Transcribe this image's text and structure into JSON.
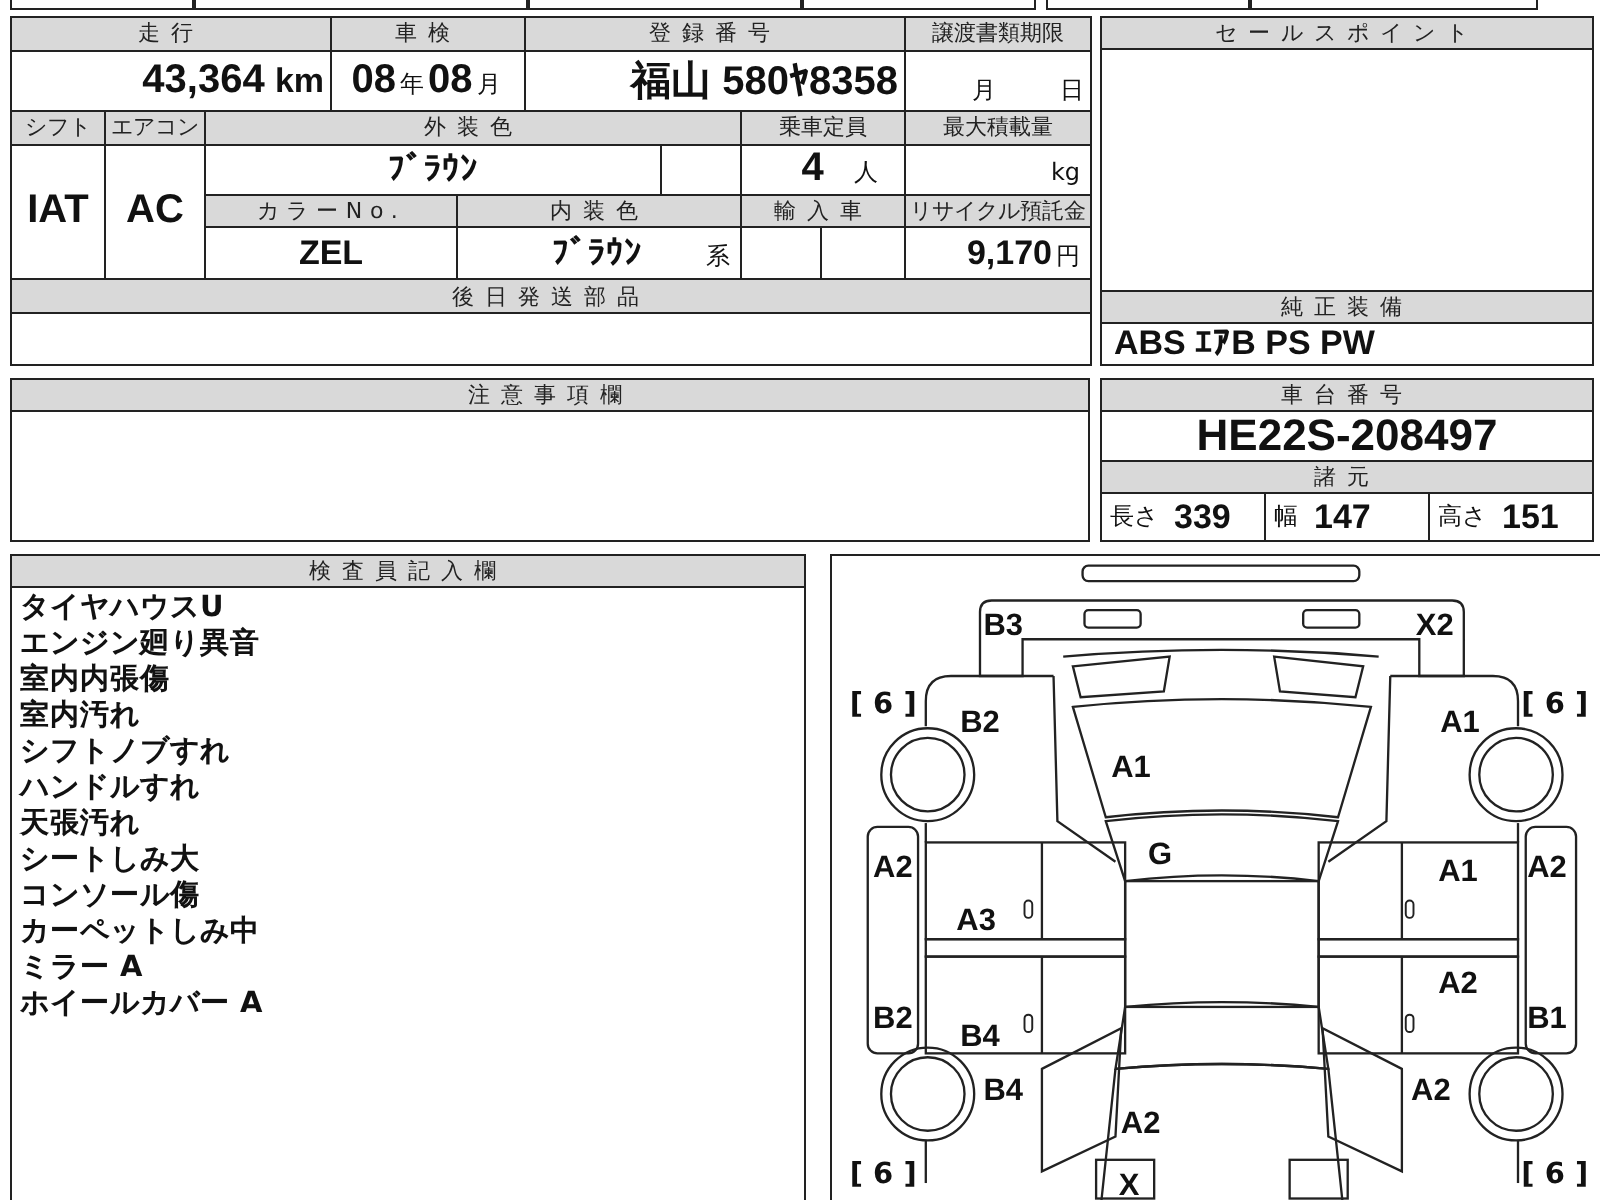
{
  "vehicle_table": {
    "mileage": {
      "label": "走行",
      "value": "43,364",
      "unit": "km"
    },
    "inspection": {
      "label": "車検",
      "year": "08",
      "year_unit": "年",
      "month": "08",
      "month_unit": "月"
    },
    "registration": {
      "label": "登録番号",
      "value": "福山 580ﾔ8358"
    },
    "transfer_deadline": {
      "label": "譲渡書類期限",
      "month_unit": "月",
      "day_unit": "日"
    },
    "shift": {
      "label": "シフト",
      "value": "IAT"
    },
    "air_conditioner": {
      "label": "エアコン",
      "value": "AC"
    },
    "exterior_color": {
      "label": "外装色",
      "value": "ﾌﾞﾗｳﾝ"
    },
    "seating_capacity": {
      "label": "乗車定員",
      "value": "4",
      "unit": "人"
    },
    "max_load": {
      "label": "最大積載量",
      "unit": "kg"
    },
    "color_no": {
      "label": "カラーNo.",
      "value": "ZEL"
    },
    "interior_color": {
      "label": "内装色",
      "value": "ﾌﾞﾗｳﾝ",
      "suffix": "系"
    },
    "imported": {
      "label": "輸入車"
    },
    "recycle_fee": {
      "label": "リサイクル預託金",
      "value": "9,170",
      "unit": "円"
    },
    "parts_to_ship": {
      "label": "後日発送部品"
    }
  },
  "sales_points": {
    "title": "セールスポイント"
  },
  "standard_equipment": {
    "title": "純正装備",
    "value": "ABS ｴｱB PS PW"
  },
  "notes": {
    "title": "注意事項欄"
  },
  "chassis": {
    "title": "車台番号",
    "value": "HE22S-208497",
    "specs_title": "諸元",
    "specs": [
      {
        "label": "長さ",
        "value": "339"
      },
      {
        "label": "幅",
        "value": "147"
      },
      {
        "label": "高さ",
        "value": "151"
      }
    ]
  },
  "inspector": {
    "title": "検査員記入欄",
    "notes": [
      "タイヤハウスU",
      "エンジン廻り異音",
      "室内内張傷",
      "室内汚れ",
      "シフトノブすれ",
      "ハンドルすれ",
      "天張汚れ",
      "シートしみ大",
      "コンソール傷",
      "カーペットしみ中",
      "ミラー A",
      "ホイールカバー A"
    ]
  },
  "diagram": {
    "marks": [
      {
        "kind": "damage",
        "text": "B3"
      },
      {
        "kind": "damage",
        "text": "X2"
      },
      {
        "kind": "tread",
        "text": "[ 6 ]"
      },
      {
        "kind": "damage",
        "text": "B2"
      },
      {
        "kind": "damage",
        "text": "A1"
      },
      {
        "kind": "damage",
        "text": "A1"
      },
      {
        "kind": "tread",
        "text": "[ 6 ]"
      },
      {
        "kind": "damage",
        "text": "A2"
      },
      {
        "kind": "damage",
        "text": "G"
      },
      {
        "kind": "damage",
        "text": "A1"
      },
      {
        "kind": "damage",
        "text": "A2"
      },
      {
        "kind": "damage",
        "text": "A3"
      },
      {
        "kind": "damage",
        "text": "B2"
      },
      {
        "kind": "damage",
        "text": "B4"
      },
      {
        "kind": "damage",
        "text": "A2"
      },
      {
        "kind": "damage",
        "text": "B1"
      },
      {
        "kind": "damage",
        "text": "B4"
      },
      {
        "kind": "damage",
        "text": "A2"
      },
      {
        "kind": "damage",
        "text": "A2"
      },
      {
        "kind": "tread",
        "text": "[ 6 ]"
      },
      {
        "kind": "damage",
        "text": "X"
      },
      {
        "kind": "tread",
        "text": "[ 6 ]"
      }
    ]
  }
}
